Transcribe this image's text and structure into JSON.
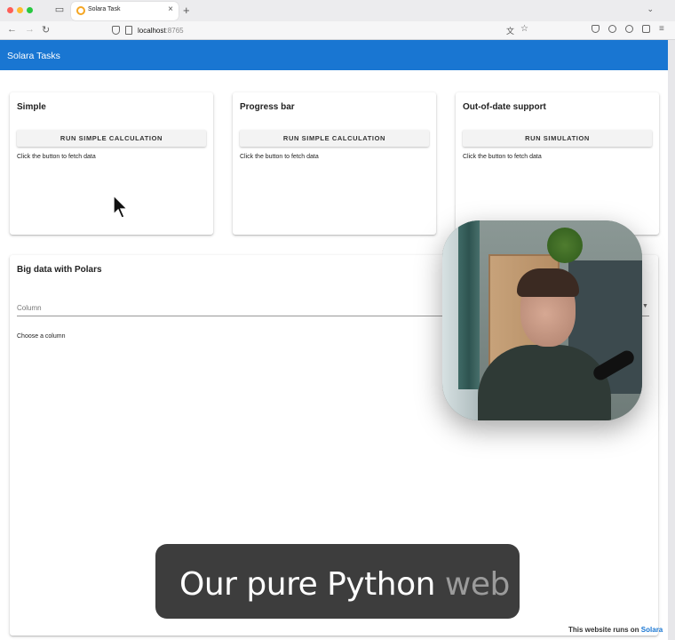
{
  "browser": {
    "tab_title": "Solara Task",
    "url_host": "localhost",
    "url_port": ":8765"
  },
  "app": {
    "title": "Solara Tasks"
  },
  "cards": [
    {
      "title": "Simple",
      "button": "RUN SIMPLE CALCULATION",
      "status": "Click the button to fetch data"
    },
    {
      "title": "Progress bar",
      "button": "RUN SIMPLE CALCULATION",
      "status": "Click the button to fetch data"
    },
    {
      "title": "Out-of-date support",
      "button": "RUN SIMULATION",
      "status": "Click the button to fetch data"
    }
  ],
  "big_card": {
    "title": "Big data with Polars",
    "select_label": "Column",
    "helper": "Choose a column"
  },
  "footer": {
    "text": "This website runs on ",
    "link": "Solara"
  },
  "caption": {
    "main": "Our pure Python",
    "dim": "web"
  }
}
